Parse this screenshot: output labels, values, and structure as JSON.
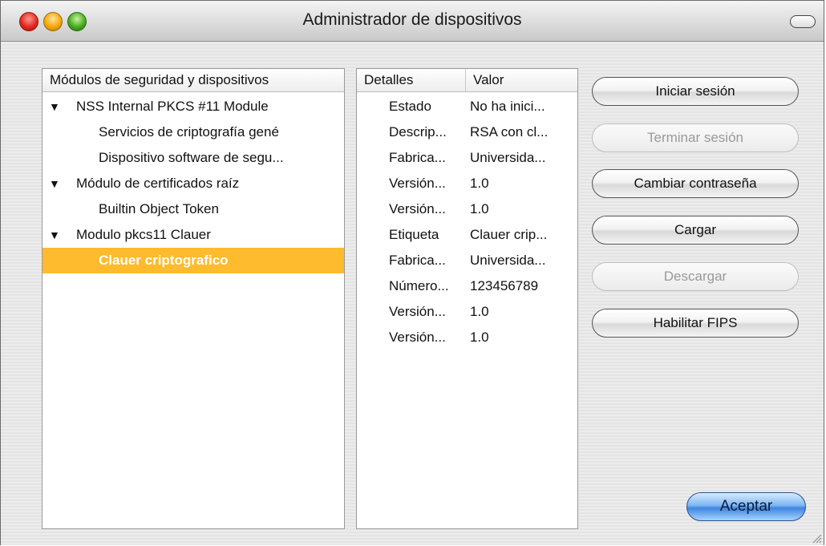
{
  "window": {
    "title": "Administrador de dispositivos"
  },
  "modules_panel": {
    "header": "Módulos de seguridad y dispositivos",
    "items": [
      {
        "label": "NSS Internal PKCS #11 Module",
        "level": 0,
        "expanded": true
      },
      {
        "label": "Servicios de criptografía gené",
        "level": 1
      },
      {
        "label": "Dispositivo software de segu...",
        "level": 1
      },
      {
        "label": "Módulo de certificados raíz",
        "level": 0,
        "expanded": true
      },
      {
        "label": "Builtin Object Token",
        "level": 1
      },
      {
        "label": "Modulo pkcs11 Clauer",
        "level": 0,
        "expanded": true
      },
      {
        "label": "Clauer criptografico",
        "level": 1,
        "selected": true
      }
    ]
  },
  "details_panel": {
    "col_details": "Detalles",
    "col_value": "Valor",
    "rows": [
      {
        "key": "Estado",
        "value": "No ha inici..."
      },
      {
        "key": "Descrip...",
        "value": "RSA con cl..."
      },
      {
        "key": "Fabrica...",
        "value": "Universida..."
      },
      {
        "key": "Versión...",
        "value": "1.0"
      },
      {
        "key": "Versión...",
        "value": "1.0"
      },
      {
        "key": "Etiqueta",
        "value": "Clauer crip..."
      },
      {
        "key": "Fabrica...",
        "value": "Universida..."
      },
      {
        "key": "Número...",
        "value": "123456789"
      },
      {
        "key": "Versión...",
        "value": "1.0"
      },
      {
        "key": "Versión...",
        "value": "1.0"
      }
    ]
  },
  "buttons": {
    "login": "Iniciar sesión",
    "logout": "Terminar sesión",
    "change_password": "Cambiar contraseña",
    "load": "Cargar",
    "unload": "Descargar",
    "enable_fips": "Habilitar FIPS",
    "accept": "Aceptar"
  },
  "icons": {
    "close": "close-icon",
    "minimize": "minimize-icon",
    "zoom": "zoom-icon",
    "expand": "triangle-down-icon",
    "resize": "resize-grip-icon"
  },
  "colors": {
    "selection": "#fdbb2d",
    "accept_button": "#3e86e0"
  }
}
